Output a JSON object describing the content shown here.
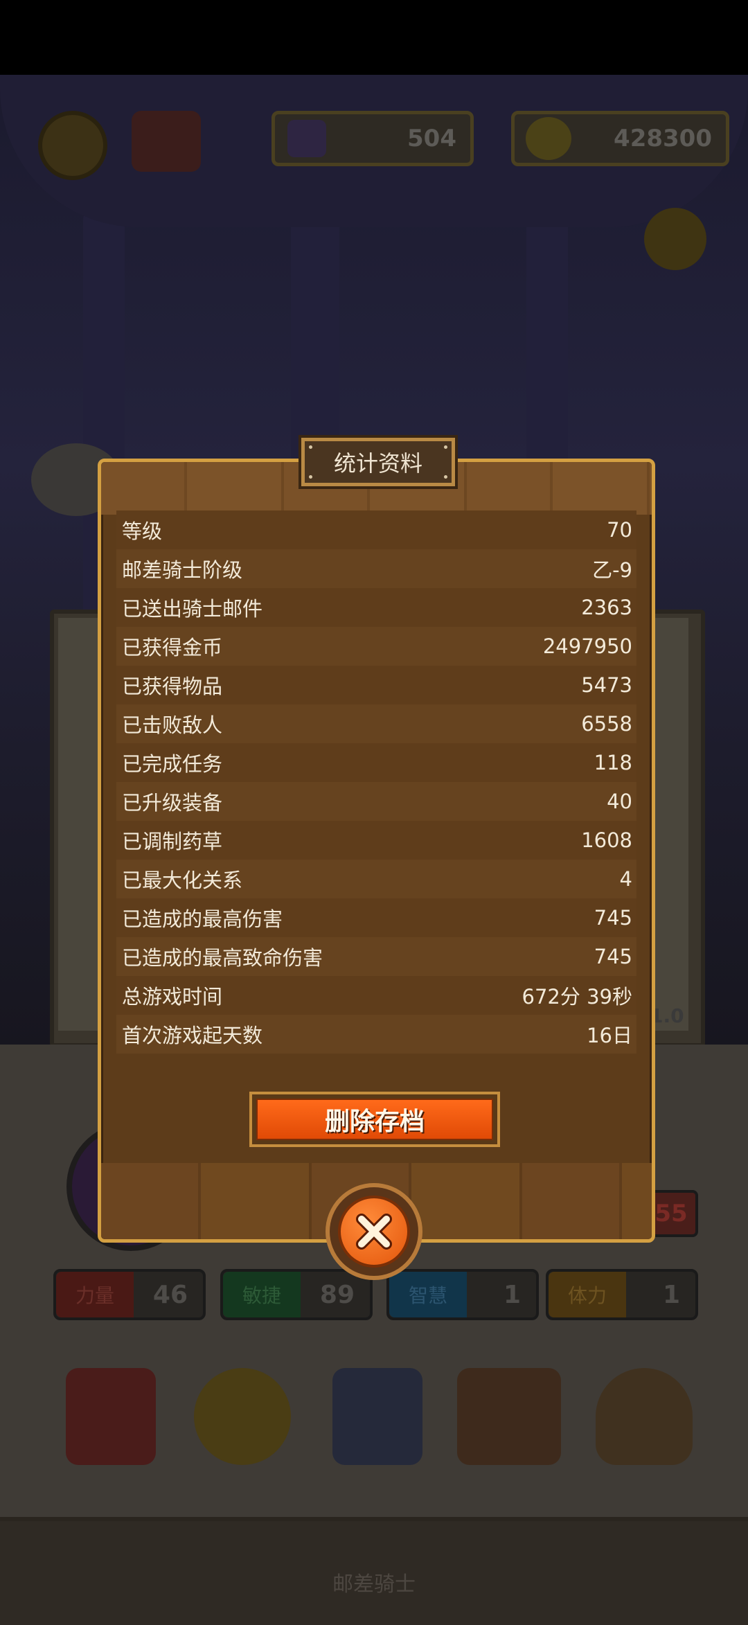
{
  "hud": {
    "gems": "504",
    "coins": "428300"
  },
  "background": {
    "version": "1.0",
    "red_badge": "55",
    "stats": [
      {
        "label": "力量",
        "value": "46",
        "color": "#4a1915"
      },
      {
        "label": "敏捷",
        "value": "89",
        "color": "#14381f"
      },
      {
        "label": "智慧",
        "value": "1",
        "color": "#11354a"
      },
      {
        "label": "体力",
        "value": "1",
        "color": "#4a3510"
      }
    ],
    "nav_label": "邮差骑士",
    "icons": [
      "book-icon",
      "star-coin-icon",
      "card-icon",
      "equipment-icon",
      "loot-bag-icon"
    ]
  },
  "modal": {
    "title": "统计资料",
    "rows": [
      {
        "label": "等级",
        "value": "70"
      },
      {
        "label": "邮差骑士阶级",
        "value": "乙-9"
      },
      {
        "label": "已送出骑士邮件",
        "value": "2363"
      },
      {
        "label": "已获得金币",
        "value": "2497950"
      },
      {
        "label": "已获得物品",
        "value": "5473"
      },
      {
        "label": "已击败敌人",
        "value": "6558"
      },
      {
        "label": "已完成任务",
        "value": "118"
      },
      {
        "label": "已升级装备",
        "value": "40"
      },
      {
        "label": "已调制药草",
        "value": "1608"
      },
      {
        "label": "已最大化关系",
        "value": "4"
      },
      {
        "label": "已造成的最高伤害",
        "value": "745"
      },
      {
        "label": "已造成的最高致命伤害",
        "value": "745"
      },
      {
        "label": "总游戏时间",
        "value": "672分 39秒"
      },
      {
        "label": "首次游戏起天数",
        "value": "16日"
      }
    ],
    "delete_label": "删除存档",
    "close_icon": "close-icon"
  }
}
